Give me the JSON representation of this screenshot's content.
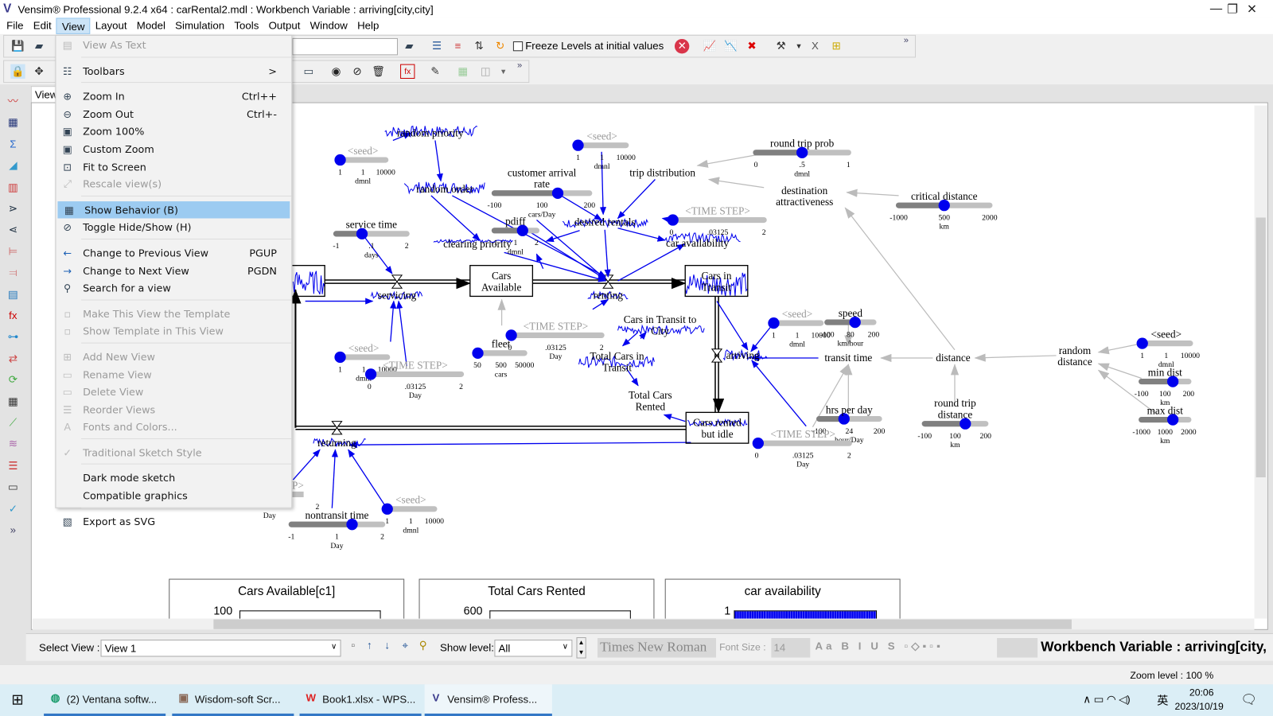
{
  "window": {
    "title": "Vensim® Professional 9.2.4 x64 : carRental2.mdl : Workbench Variable : arriving[city,city]",
    "controls": [
      "—",
      "❐",
      "✕"
    ]
  },
  "menubar": [
    "File",
    "Edit",
    "View",
    "Layout",
    "Model",
    "Simulation",
    "Tools",
    "Output",
    "Window",
    "Help"
  ],
  "toolbar": {
    "freeze_label": "Freeze Levels at initial values",
    "freeze_checked": false,
    "more": "»"
  },
  "view_menu": {
    "items": [
      {
        "label": "View As Text",
        "icon": "document-icon",
        "disabled": true
      },
      {
        "sep": true
      },
      {
        "label": "Toolbars",
        "icon": "toolbar-icon",
        "submenu": ">"
      },
      {
        "sep": true
      },
      {
        "label": "Zoom In",
        "icon": "zoom-in-icon",
        "shortcut": "Ctrl++"
      },
      {
        "label": "Zoom Out",
        "icon": "zoom-out-icon",
        "shortcut": "Ctrl+-"
      },
      {
        "label": "Zoom 100%",
        "icon": "zoom-100-icon"
      },
      {
        "label": "Custom Zoom",
        "icon": "custom-zoom-icon"
      },
      {
        "label": "Fit to Screen",
        "icon": "fit-screen-icon"
      },
      {
        "label": "Rescale view(s)",
        "icon": "rescale-icon",
        "disabled": true
      },
      {
        "sep": true
      },
      {
        "label": "Show Behavior (B)",
        "icon": "behavior-icon",
        "highlighted": true
      },
      {
        "label": "Toggle Hide/Show (H)",
        "icon": "hide-eye-icon"
      },
      {
        "sep": true
      },
      {
        "label": "Change to Previous View",
        "icon": "arrow-left-icon",
        "shortcut": "PGUP"
      },
      {
        "label": "Change to Next View",
        "icon": "arrow-right-icon",
        "shortcut": "PGDN"
      },
      {
        "label": "Search for a view",
        "icon": "search-view-icon"
      },
      {
        "sep": true
      },
      {
        "label": "Make This View the Template",
        "icon": "template-icon",
        "disabled": true
      },
      {
        "label": "Show Template in This View",
        "icon": "show-template-icon",
        "disabled": true
      },
      {
        "sep": true
      },
      {
        "label": "Add New View",
        "icon": "add-view-icon",
        "disabled": true
      },
      {
        "label": "Rename View",
        "icon": "rename-view-icon",
        "disabled": true
      },
      {
        "label": "Delete View",
        "icon": "delete-view-icon",
        "disabled": true
      },
      {
        "label": "Reorder Views",
        "icon": "reorder-icon",
        "disabled": true
      },
      {
        "label": "Fonts and Colors...",
        "icon": "fonts-icon",
        "disabled": true
      },
      {
        "sep": true
      },
      {
        "label": "Traditional Sketch Style",
        "icon": "check-icon",
        "disabled": true
      },
      {
        "sep": true
      },
      {
        "label": "Dark mode sketch",
        "icon": ""
      },
      {
        "label": "Compatible graphics",
        "icon": ""
      },
      {
        "sep": true
      },
      {
        "label": "Export as SVG",
        "icon": "svg-export-icon"
      }
    ]
  },
  "tab": {
    "label": "View 1"
  },
  "diagram": {
    "variables": [
      {
        "id": "random-priority",
        "lines": [
          "random priority"
        ]
      },
      {
        "id": "random-order",
        "lines": [
          "random order"
        ]
      },
      {
        "id": "clearing-priority",
        "lines": [
          "clearing priority"
        ]
      },
      {
        "id": "desired-rentals",
        "lines": [
          "desired rentals"
        ]
      },
      {
        "id": "trip-distribution",
        "lines": [
          "trip distribution"
        ]
      },
      {
        "id": "car-availability",
        "lines": [
          "car availability"
        ]
      },
      {
        "id": "destination-attractiveness",
        "lines": [
          "destination",
          "attractiveness"
        ]
      },
      {
        "id": "servicing",
        "lines": [
          "servicing"
        ]
      },
      {
        "id": "renting",
        "lines": [
          "renting"
        ]
      },
      {
        "id": "cars-in-transit-to-city",
        "lines": [
          "Cars in Transit to",
          "City"
        ]
      },
      {
        "id": "total-cars-in-transit",
        "lines": [
          "Total Cars in",
          "Transit"
        ]
      },
      {
        "id": "total-cars-rented",
        "lines": [
          "Total Cars",
          "Rented"
        ]
      },
      {
        "id": "arriving",
        "lines": [
          "arriving"
        ]
      },
      {
        "id": "transit-time",
        "lines": [
          "transit time"
        ]
      },
      {
        "id": "distance",
        "lines": [
          "distance"
        ]
      },
      {
        "id": "random-distance",
        "lines": [
          "random",
          "distance"
        ]
      },
      {
        "id": "returning",
        "lines": [
          "returning"
        ]
      }
    ],
    "stocks": [
      {
        "id": "cars-available",
        "lines": [
          "Cars",
          "Available"
        ]
      },
      {
        "id": "cars-in-transit",
        "lines": [
          "Cars in",
          "Transit"
        ]
      },
      {
        "id": "cars-rented-but-idle",
        "lines": [
          "Cars rented",
          "but idle"
        ]
      },
      {
        "id": "cars-returned",
        "lines": []
      }
    ],
    "sliders": [
      {
        "id": "seed-1",
        "label": "<seed>",
        "shadow": true,
        "min": "1",
        "value": "1",
        "max": "10000",
        "unit": "dmnl"
      },
      {
        "id": "seed-2",
        "label": "<seed>",
        "shadow": true,
        "min": "1",
        "value": "1",
        "max": "10000",
        "unit": "dmnl"
      },
      {
        "id": "customer-arrival-rate",
        "label": [
          "customer arrival",
          "rate"
        ],
        "min": "-100",
        "value": "100",
        "max": "200",
        "unit": "cars/Day"
      },
      {
        "id": "round-trip-prob",
        "label": "round trip prob",
        "min": "0",
        "value": ".5",
        "max": "1",
        "unit": "dmnl"
      },
      {
        "id": "critical-distance",
        "label": "critical distance",
        "min": "-1000",
        "value": "500",
        "max": "2000",
        "unit": "km"
      },
      {
        "id": "time-step-1",
        "label": "<TIME STEP>",
        "shadow": true,
        "min": "0",
        "value": ".03125",
        "max": "2",
        "unit": ""
      },
      {
        "id": "service-time",
        "label": "service time",
        "min": "-1",
        "value": ".1",
        "max": "2",
        "unit": "days"
      },
      {
        "id": "pdiff",
        "label": "pdiff",
        "min": "-1",
        "value": "1",
        "max": "2",
        "unit": "dmnl"
      },
      {
        "id": "seed-3",
        "label": "<seed>",
        "shadow": true,
        "min": "1",
        "value": "1",
        "max": "10000",
        "unit": "dmnl"
      },
      {
        "id": "time-step-2",
        "label": "<TIME STEP>",
        "shadow": true,
        "min": "0",
        "value": ".03125",
        "max": "2",
        "unit": "Day"
      },
      {
        "id": "fleet",
        "label": "fleet",
        "min": "50",
        "value": "500",
        "max": "50000",
        "unit": "cars"
      },
      {
        "id": "time-step-3",
        "label": "<TIME STEP>",
        "shadow": true,
        "min": "0",
        "value": ".03125",
        "max": "2",
        "unit": "Day"
      },
      {
        "id": "seed-4",
        "label": "<seed>",
        "shadow": true,
        "min": "1",
        "value": "1",
        "max": "10000",
        "unit": "dmnl"
      },
      {
        "id": "speed",
        "label": "speed",
        "min": "-100",
        "value": "80",
        "max": "200",
        "unit": "km/hour"
      },
      {
        "id": "hrs-per-day",
        "label": "hrs per day",
        "min": "-100",
        "value": "24",
        "max": "200",
        "unit": "hour/Day"
      },
      {
        "id": "time-step-4",
        "label": "<TIME STEP>",
        "shadow": true,
        "min": "0",
        "value": ".03125",
        "max": "2",
        "unit": "Day"
      },
      {
        "id": "round-trip-distance",
        "label": [
          "round trip",
          "distance"
        ],
        "min": "-100",
        "value": "100",
        "max": "200",
        "unit": "km"
      },
      {
        "id": "seed-5",
        "label": "<seed>",
        "shadow": false,
        "min": "1",
        "value": "1",
        "max": "10000",
        "unit": "dmnl"
      },
      {
        "id": "min-dist",
        "label": "min dist",
        "min": "-100",
        "value": "100",
        "max": "200",
        "unit": "km"
      },
      {
        "id": "max-dist",
        "label": "max dist",
        "min": "-1000",
        "value": "1000",
        "max": "2000",
        "unit": "km"
      },
      {
        "id": "seed-6",
        "label": "<seed>",
        "shadow": true,
        "min": "1",
        "value": "1",
        "max": "10000",
        "unit": "dmnl"
      },
      {
        "id": "nontransit-time",
        "label": "nontransit time",
        "min": "-1",
        "value": "1",
        "max": "2",
        "unit": "Day"
      }
    ],
    "partial": {
      "label": "P>",
      "tick": "2",
      "unit": "Day"
    }
  },
  "graphs": [
    {
      "title": "Cars Available[c1]",
      "ytop": "100"
    },
    {
      "title": "Total Cars Rented",
      "ytop": "600"
    },
    {
      "title": "car availability",
      "ytop": "1"
    }
  ],
  "bottom": {
    "select_view_label": "Select View :",
    "select_view_value": "View 1",
    "show_level_label": "Show level:",
    "show_level_value": "All",
    "font_name": "Times New Roman",
    "font_size_label": "Font Size :",
    "font_size_value": "14",
    "workbench": "Workbench Variable : arriving[city,"
  },
  "status": {
    "zoom": "Zoom level : 100 %"
  },
  "taskbar": {
    "apps": [
      "(2) Ventana softw...",
      "Wisdom-soft Scr...",
      "Book1.xlsx - WPS...",
      "Vensim® Profess..."
    ],
    "time": "20:06",
    "date": "2023/10/19",
    "ime": "英"
  },
  "colors": {
    "accent": "#0000ee",
    "menu_highlight": "#9ccbf1",
    "slider_track": "#c0c0c0",
    "slider_fill": "#808080",
    "shadow_text": "#999999"
  }
}
